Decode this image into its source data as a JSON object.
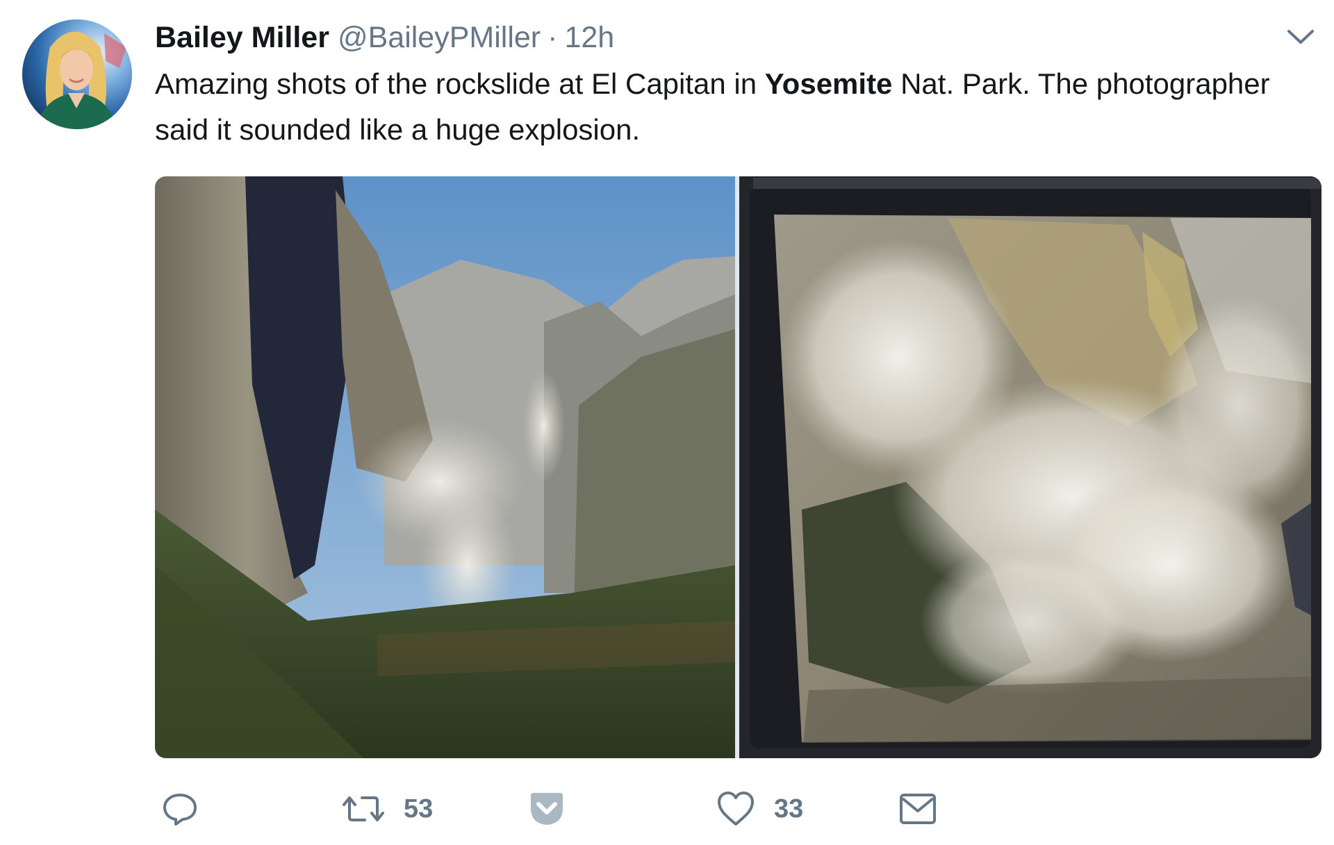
{
  "tweet": {
    "author_name": "Bailey Miller",
    "handle": "@BaileyPMiller",
    "separator": "·",
    "timestamp": "12h",
    "text_part1": "Amazing shots of the rockslide at El Capitan in ",
    "text_bold": "Yosemite",
    "text_part2": " Nat. Park. The photographer said it sounded like a huge explosion."
  },
  "media": {
    "photos": [
      {
        "subject": "rockslide-photo-el-capitan-valley"
      },
      {
        "subject": "rockslide-photo-screen-dust-cloud"
      }
    ]
  },
  "actions": {
    "reply_icon": "reply-icon",
    "retweet_icon": "retweet-icon",
    "retweet_count": "53",
    "pocket_icon": "pocket-icon",
    "like_icon": "heart-icon",
    "like_count": "33",
    "dm_icon": "envelope-icon"
  },
  "colors": {
    "text": "#14171a",
    "secondary": "#657786",
    "pocket": "#aab8c2"
  }
}
